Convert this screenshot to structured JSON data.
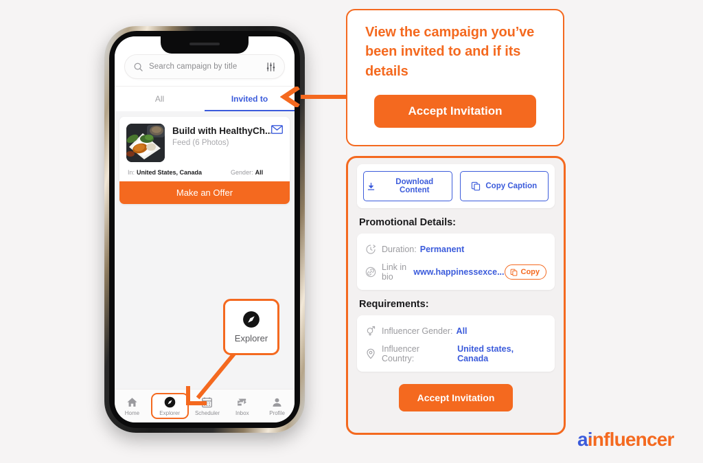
{
  "colors": {
    "brand_orange": "#f4691f",
    "brand_blue": "#3b5bdb",
    "page_background": "#f6f4f4",
    "panel_background": "#f3f1f1"
  },
  "phone": {
    "search": {
      "placeholder": "Search campaign by title",
      "search_icon": "search-icon",
      "filter_icon": "filter-sliders-icon"
    },
    "tabs": [
      {
        "label": "All",
        "active": false
      },
      {
        "label": "Invited to",
        "active": true
      }
    ],
    "campaign_card": {
      "title": "Build with HealthyCh...",
      "subtitle": "Feed (6 Photos)",
      "mail_icon": "envelope-icon",
      "meta": {
        "location_label": "In:",
        "location_value": "United States, Canada",
        "gender_label": "Gender:",
        "gender_value": "All"
      },
      "offer_button": "Make an Offer"
    },
    "explorer_callout": {
      "label": "Explorer",
      "icon": "compass-icon"
    },
    "bottom_nav": [
      {
        "label": "Home",
        "icon": "home-icon",
        "highlight": false
      },
      {
        "label": "Explorer",
        "icon": "compass-icon",
        "highlight": true
      },
      {
        "label": "Scheduler",
        "icon": "calendar-icon",
        "highlight": false
      },
      {
        "label": "Inbox",
        "icon": "inbox-arrows-icon",
        "highlight": false
      },
      {
        "label": "Profile",
        "icon": "person-icon",
        "highlight": false
      }
    ]
  },
  "tip_card": {
    "text": "View the campaign you’ve been invited to and if its details",
    "accept_button": "Accept Invitation"
  },
  "detail_panel": {
    "actions": [
      {
        "label": "Download Content",
        "icon": "download-icon"
      },
      {
        "label": "Copy Caption",
        "icon": "copy-icon"
      }
    ],
    "promotional": {
      "heading": "Promotional Details:",
      "duration_label": "Duration:",
      "duration_value": "Permanent",
      "duration_icon": "clock-arrow-icon",
      "link_label": "Link in bio",
      "link_value": "www.happinessexce...",
      "link_icon": "link-chain-icon",
      "copy_button": "Copy",
      "copy_button_icon": "copy-icon"
    },
    "requirements": {
      "heading": "Requirements:",
      "gender_label": "Influencer Gender:",
      "gender_value": "All",
      "gender_icon": "gender-symbol-icon",
      "country_label": "Influencer Country:",
      "country_value": "United states, Canada",
      "country_icon": "location-pin-icon"
    },
    "accept_button": "Accept Invitation"
  },
  "logo": {
    "part_a": "a",
    "part_i": "i",
    "part_rest": "nfluencer"
  }
}
